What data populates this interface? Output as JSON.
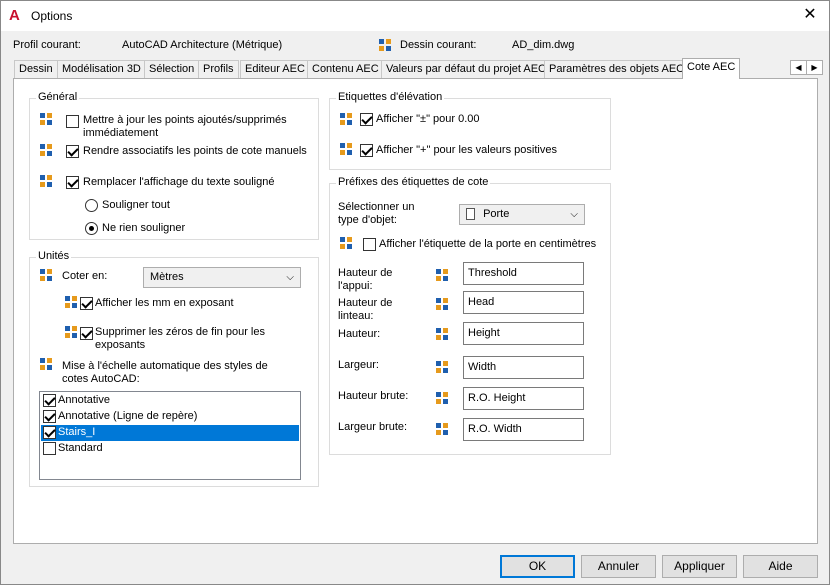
{
  "window": {
    "title": "Options"
  },
  "header": {
    "profile_label": "Profil courant:",
    "profile_value": "AutoCAD Architecture (Métrique)",
    "drawing_label": "Dessin courant:",
    "drawing_value": "AD_dim.dwg"
  },
  "tabs": [
    "Dessin",
    "Modélisation 3D",
    "Sélection",
    "Profils",
    "Editeur AEC",
    "Contenu AEC",
    "Valeurs par défaut du projet AEC",
    "Paramètres des objets AEC",
    "Cote AEC"
  ],
  "general": {
    "title": "Général",
    "cb1": "Mettre à jour les points ajoutés/supprimés immédiatement",
    "cb2": "Rendre associatifs les points de cote manuels",
    "cb3": "Remplacer l'affichage du texte souligné",
    "radio1": "Souligner tout",
    "radio2": "Ne rien souligner"
  },
  "units": {
    "title": "Unités",
    "coter_label": "Coter en:",
    "coter_value": "Mètres",
    "cb_mm": "Afficher les mm en exposant",
    "cb_zeros": "Supprimer les zéros de fin pour les exposants",
    "scale_label": "Mise à l'échelle automatique des styles de cotes AutoCAD:",
    "styles": [
      "Annotative",
      "Annotative (Ligne de repère)",
      "Stairs_I",
      "Standard"
    ]
  },
  "elevation": {
    "title": "Etiquettes d'élévation",
    "cb1": "Afficher \"±\" pour 0.00",
    "cb2": "Afficher \"+\" pour les valeurs positives"
  },
  "prefixes": {
    "title": "Préfixes des étiquettes de cote",
    "select_label": "Sélectionner un type d'objet:",
    "select_value": "Porte",
    "cb_door": "Afficher l'étiquette de la porte en centimètres",
    "fields": [
      {
        "label": "Hauteur de l'appui:",
        "value": "Threshold"
      },
      {
        "label": "Hauteur de linteau:",
        "value": "Head"
      },
      {
        "label": "Hauteur:",
        "value": "Height"
      },
      {
        "label": "Largeur:",
        "value": "Width"
      },
      {
        "label": "Hauteur brute:",
        "value": "R.O. Height"
      },
      {
        "label": "Largeur brute:",
        "value": "R.O. Width"
      }
    ]
  },
  "buttons": {
    "ok": "OK",
    "cancel": "Annuler",
    "apply": "Appliquer",
    "help": "Aide"
  },
  "colors": {
    "accent": "#0078d7",
    "brand": "#c8102e"
  }
}
